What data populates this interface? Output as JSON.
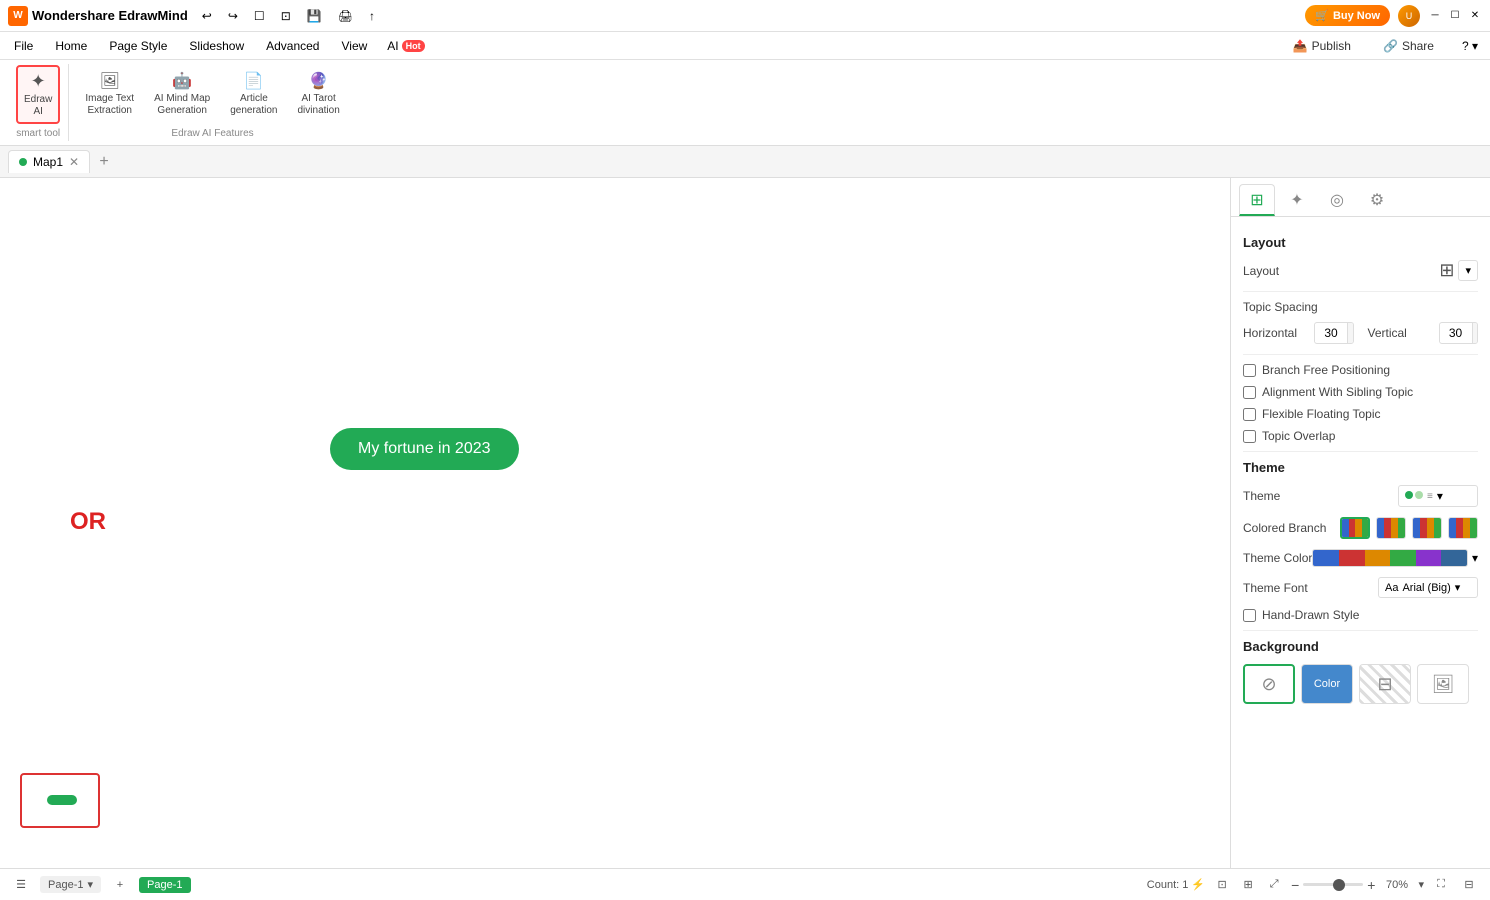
{
  "app": {
    "title": "Wondershare EdrawMind",
    "logo_text": "W"
  },
  "title_bar": {
    "buy_now": "Buy Now",
    "undo": "↩",
    "redo": "↪",
    "new": "☐",
    "open": "📂",
    "print": "🖨",
    "export": "↑"
  },
  "menu": {
    "items": [
      "File",
      "Home",
      "Page Style",
      "Slideshow",
      "Advanced",
      "View"
    ],
    "ai_label": "AI",
    "hot_label": "Hot",
    "publish": "Publish",
    "share": "Share"
  },
  "toolbar": {
    "smart_tool_label": "smart tool",
    "ai_features_label": "Edraw AI Features",
    "tools": [
      {
        "id": "edraw-ai",
        "icon": "✦",
        "label": "Edraw\nAI",
        "active": true
      },
      {
        "id": "image-text-extraction",
        "icon": "🖼",
        "label": "Image Text\nExtraction",
        "active": false
      },
      {
        "id": "ai-mind-map",
        "icon": "🧠",
        "label": "AI Mind Map\nGeneration",
        "active": false
      },
      {
        "id": "article-generation",
        "icon": "📝",
        "label": "Article\ngeneration",
        "active": false
      },
      {
        "id": "ai-tarot",
        "icon": "🔮",
        "label": "AI Tarot\ndivination",
        "active": false
      }
    ]
  },
  "tabs": {
    "items": [
      {
        "id": "map1",
        "label": "Map1",
        "active": true
      }
    ],
    "add_label": "+"
  },
  "canvas": {
    "node_label": "My fortune in 2023",
    "or_label": "OR"
  },
  "right_panel": {
    "tabs": [
      {
        "id": "layout",
        "icon": "⊞",
        "active": true
      },
      {
        "id": "sparkle",
        "icon": "✦",
        "active": false
      },
      {
        "id": "location",
        "icon": "⊙",
        "active": false
      },
      {
        "id": "settings",
        "icon": "⚙",
        "active": false
      }
    ],
    "layout": {
      "title": "Layout",
      "layout_label": "Layout",
      "topic_spacing_label": "Topic Spacing",
      "horizontal_label": "Horizontal",
      "horizontal_value": "30",
      "vertical_label": "Vertical",
      "vertical_value": "30",
      "checkboxes": [
        {
          "id": "branch-free",
          "label": "Branch Free Positioning",
          "checked": false
        },
        {
          "id": "alignment-sibling",
          "label": "Alignment With Sibling Topic",
          "checked": false
        },
        {
          "id": "flexible-floating",
          "label": "Flexible Floating Topic",
          "checked": false
        },
        {
          "id": "topic-overlap",
          "label": "Topic Overlap",
          "checked": false
        }
      ]
    },
    "theme": {
      "title": "Theme",
      "theme_label": "Theme",
      "colored_branch_label": "Colored Branch",
      "theme_color_label": "Theme Color",
      "theme_font_label": "Theme Font",
      "theme_font_value": "Arial (Big)",
      "hand_drawn_label": "Hand-Drawn Style",
      "colors": [
        "#3366cc",
        "#cc3333",
        "#dd8800",
        "#33aa44",
        "#8833cc",
        "#336699"
      ],
      "branch_colors_1": [
        "#3366cc",
        "#cc3333",
        "#dd8800",
        "#33aa44"
      ],
      "branch_colors_2": [
        "#3366cc",
        "#cc3333",
        "#dd8800",
        "#33aa44"
      ],
      "branch_colors_3": [
        "#3366cc",
        "#cc3333",
        "#dd8800",
        "#33aa44"
      ],
      "branch_colors_4": [
        "#3366cc",
        "#cc3333",
        "#dd8800",
        "#33aa44"
      ]
    },
    "background": {
      "title": "Background",
      "options": [
        {
          "id": "none",
          "label": "None",
          "selected": true
        },
        {
          "id": "color",
          "label": "Color",
          "selected": false
        },
        {
          "id": "texture",
          "label": "Texture",
          "selected": false
        },
        {
          "id": "image",
          "label": "Image",
          "selected": false
        }
      ]
    }
  },
  "status_bar": {
    "sidebar_toggle": "☰",
    "page_label": "Page-1",
    "page_active": "Page-1",
    "add_page": "+",
    "count_label": "Count: 1",
    "zoom_value": "70%",
    "zoom_minus": "−",
    "zoom_plus": "+"
  }
}
